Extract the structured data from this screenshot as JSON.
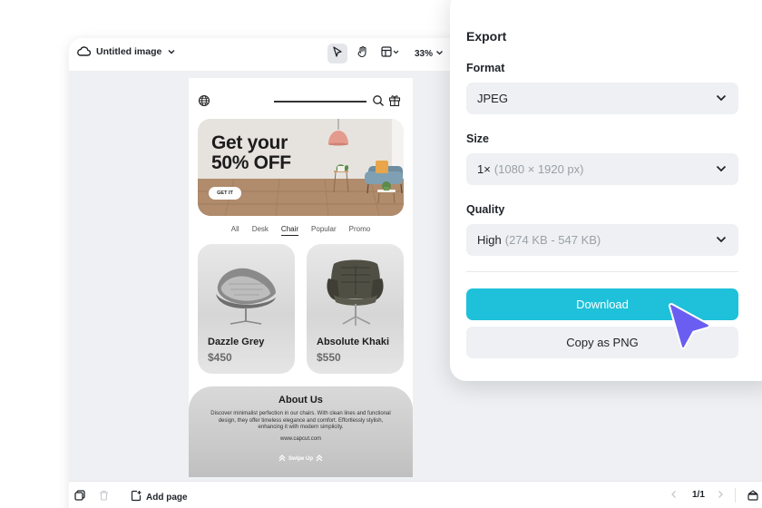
{
  "editor": {
    "doc_title": "Untitled image",
    "zoom": "33%",
    "add_page_label": "Add page",
    "page_counter": "1/1"
  },
  "design": {
    "banner_headline_line1": "Get your",
    "banner_headline_line2": "50% OFF",
    "banner_cta": "GET IT",
    "categories": [
      "All",
      "Desk",
      "Chair",
      "Popular",
      "Promo"
    ],
    "selected_category": "Chair",
    "products": [
      {
        "name": "Dazzle Grey",
        "price": "$450"
      },
      {
        "name": "Absolute Khaki",
        "price": "$550"
      }
    ],
    "about_title": "About Us",
    "about_text": "Discover minimalist perfection in our chairs. With clean lines and functional design, they offer timeless elegance and comfort. Effortlessly stylish, enhancing it with modern simplicity.",
    "about_url": "www.capcut.com",
    "swipe_label": "Swipe Up"
  },
  "export_panel": {
    "title": "Export",
    "format_label": "Format",
    "format_value": "JPEG",
    "size_label": "Size",
    "size_value": "1×",
    "size_detail": "(1080 × 1920 px)",
    "quality_label": "Quality",
    "quality_value": "High",
    "quality_detail": "(274 KB - 547 KB)",
    "download_label": "Download",
    "copy_label": "Copy as PNG"
  },
  "colors": {
    "accent": "#1ec1d9",
    "cursor": "#6a5ef2"
  }
}
